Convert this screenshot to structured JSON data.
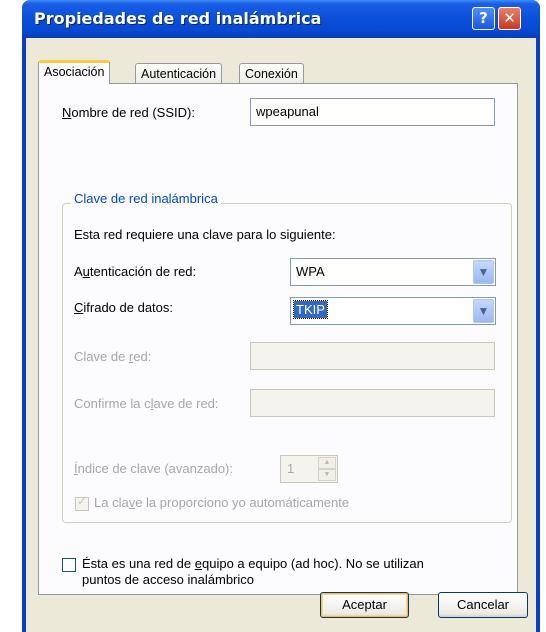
{
  "window": {
    "title": "Propiedades de red inalámbrica"
  },
  "titlebar_buttons": {
    "help": "?",
    "close": "✕"
  },
  "tabs": [
    {
      "label": "Asociación",
      "active": true
    },
    {
      "label": "Autenticación",
      "active": false
    },
    {
      "label": "Conexión",
      "active": false
    }
  ],
  "ssid": {
    "label_accel": "N",
    "label_rest": "ombre de red (SSID):",
    "value": "wpeapunal"
  },
  "group": {
    "title": "Clave de red inalámbrica",
    "description": "Esta red requiere una clave para lo siguiente:"
  },
  "auth": {
    "label_pre": "A",
    "label_accel": "u",
    "label_post": "tenticación de red:",
    "value": "WPA"
  },
  "cipher": {
    "label_accel": "C",
    "label_post": "ifrado de datos:",
    "value": "TKIP"
  },
  "network_key": {
    "label_pre": "Clave de ",
    "label_accel": "r",
    "label_post": "ed:",
    "value": ""
  },
  "confirm_key": {
    "label_pre": "Confirme la c",
    "label_accel": "l",
    "label_post": "ave de red:",
    "value": ""
  },
  "key_index": {
    "label_accel": "Í",
    "label_post": "ndice de clave (avanzado):",
    "value": "1"
  },
  "auto_key": {
    "label_pre": "La cla",
    "label_accel": "v",
    "label_post": "e la proporciono yo automáticamente",
    "checked": true
  },
  "adhoc": {
    "line1_pre": "Ésta es una red de ",
    "line1_accel": "e",
    "line1_post": "quipo a equipo (ad hoc). No se utilizan",
    "line2": "puntos de acceso inalámbrico",
    "checked": false
  },
  "buttons": {
    "ok": "Aceptar",
    "cancel": "Cancelar"
  },
  "icons": {
    "dropdown": "▼",
    "spin_up": "▲",
    "spin_down": "▼",
    "check": "✓"
  },
  "colors": {
    "titlebar": "#0a4fd9",
    "group_title": "#0046d5",
    "selection": "#316ac5",
    "dialog_bg": "#ece9d8"
  }
}
